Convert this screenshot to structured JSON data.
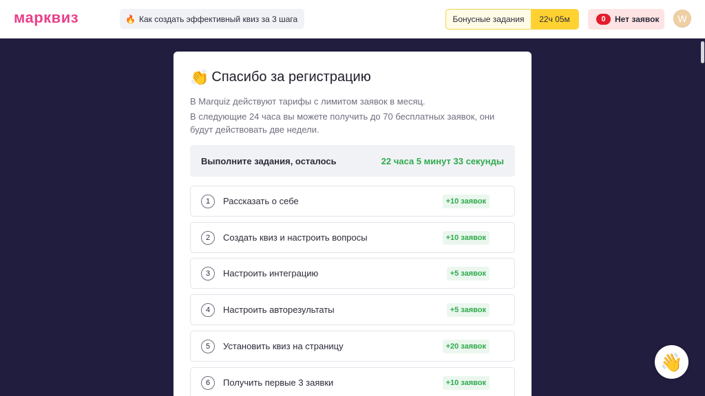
{
  "header": {
    "logo": "марквиз",
    "guide_label": "Как создать эффективный квиз за 3 шага",
    "bonus_label": "Бонусные задания",
    "bonus_timer": "22ч 05м",
    "leads_count": "0",
    "leads_label": "Нет заявок",
    "avatar_letter": "W"
  },
  "card": {
    "title": "Спасибо за регистрацию",
    "desc1": "В Marquiz действуют тарифы с лимитом заявок в месяц.",
    "desc2": "В следующие 24 часа вы можете получить до 70 бесплатных заявок, они будут действовать две недели.",
    "deadline_label": "Выполните задания, осталось",
    "deadline_left": "22 часа 5 минут 33 секунды"
  },
  "tasks": [
    {
      "num": "1",
      "name": "Рассказать о себе",
      "reward": "+10 заявок"
    },
    {
      "num": "2",
      "name": "Создать квиз и настроить вопросы",
      "reward": "+10 заявок"
    },
    {
      "num": "3",
      "name": "Настроить интеграцию",
      "reward": "+5 заявок"
    },
    {
      "num": "4",
      "name": "Настроить авторезультаты",
      "reward": "+5 заявок"
    },
    {
      "num": "5",
      "name": "Установить квиз на страницу",
      "reward": "+20 заявок"
    },
    {
      "num": "6",
      "name": "Получить первые 3 заявки",
      "reward": "+10 заявок"
    }
  ],
  "colors": {
    "brand": "#e93f8a",
    "background": "#211d3f",
    "accent_yellow": "#ffd232",
    "success_green": "#2faa4e",
    "alert_red": "#e51b2d"
  },
  "icons": {
    "guide": "flame-icon",
    "title": "clapping-hands-icon",
    "helper": "waving-hand-icon"
  }
}
